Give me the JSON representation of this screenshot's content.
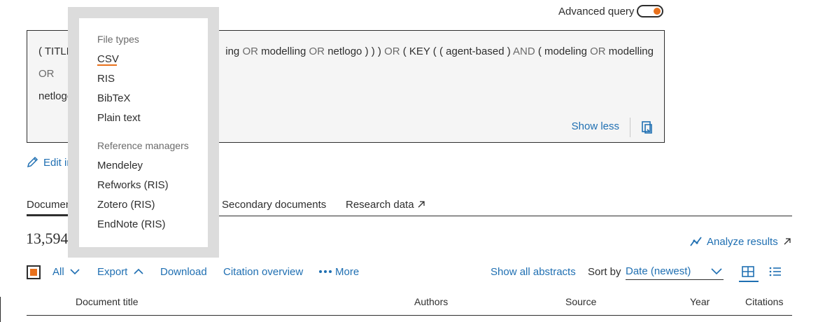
{
  "header": {
    "advanced_query_label": "Advanced query",
    "advanced_query_on": true
  },
  "query": {
    "line1_a": "( TITLE (",
    "line1_b": "ing",
    "line1_c": "OR",
    "line1_d": "modelling",
    "line1_e": "OR",
    "line1_f": "netlogo ) ) )",
    "line1_g": "OR",
    "line1_h": "( KEY ( ( agent-based )",
    "line1_i": "AND",
    "line1_j": "( modeling",
    "line1_k": "OR",
    "line1_l": "modelling",
    "line1_m": "OR",
    "line2_a": "netlogo )",
    "show_less": "Show less",
    "copy_icon": "copy-icon"
  },
  "edit_link": {
    "label": "Edit in a",
    "icon": "pencil-icon"
  },
  "tabs": [
    {
      "label": "Documents"
    },
    {
      "label": "Secondary documents"
    },
    {
      "label": "Research data"
    }
  ],
  "results": {
    "count_text": "13,594 c",
    "analyze_label": "Analyze results"
  },
  "toolbar": {
    "all_label": "All",
    "export_label": "Export",
    "download_label": "Download",
    "citation_overview_label": "Citation overview",
    "more_label": "More",
    "show_abstracts_label": "Show all abstracts",
    "sort_by_label": "Sort by",
    "sort_value": "Date (newest)"
  },
  "table_headers": [
    "Document title",
    "Authors",
    "Source",
    "Year",
    "Citations"
  ],
  "export_menu": {
    "file_types_heading": "File types",
    "file_types": [
      "CSV",
      "RIS",
      "BibTeX",
      "Plain text"
    ],
    "ref_managers_heading": "Reference managers",
    "ref_managers": [
      "Mendeley",
      "Refworks (RIS)",
      "Zotero (RIS)",
      "EndNote (RIS)"
    ]
  },
  "colors": {
    "accent_orange": "#e9711c",
    "link_blue": "#1f6fb2",
    "text_dark": "#2e2e2e",
    "muted_grey": "#6b6b6b",
    "query_bg": "#f5f5f5"
  }
}
